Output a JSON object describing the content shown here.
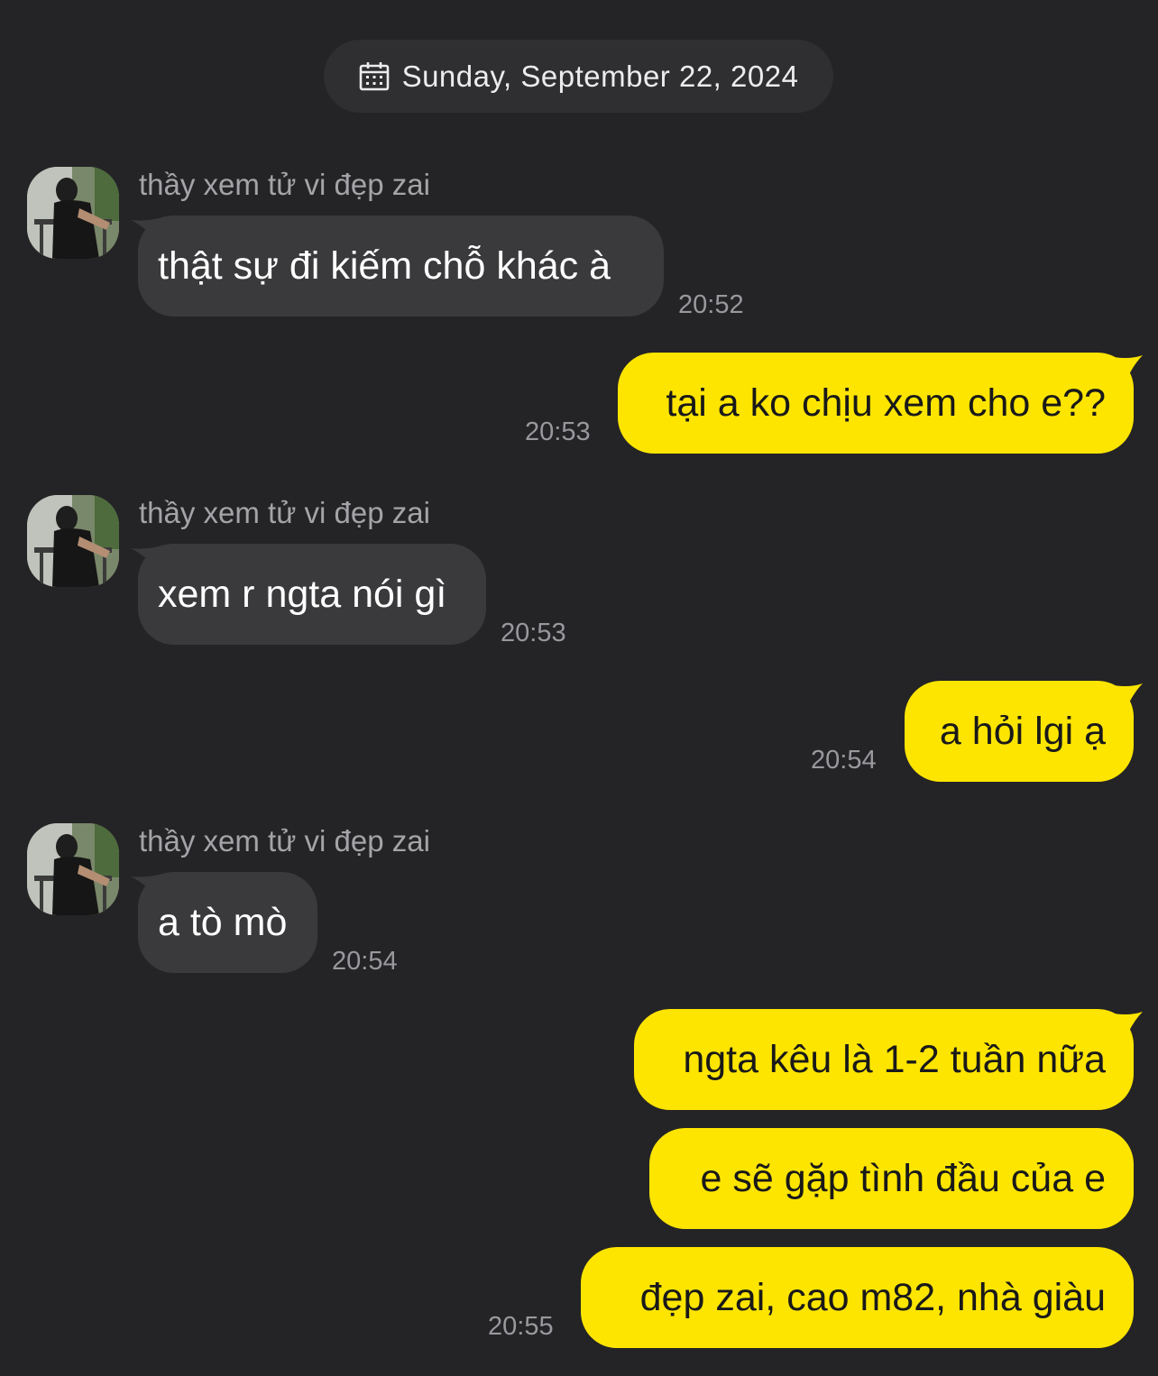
{
  "date_divider": {
    "icon": "calendar-icon",
    "text": "Sunday, September 22, 2024"
  },
  "colors": {
    "background": "#242426",
    "incoming_bubble": "#3a3a3c",
    "outgoing_bubble": "#fee500",
    "timestamp": "#98989d"
  },
  "messages": [
    {
      "sender": "thầy xem tử vi đẹp zai",
      "text": "thật sự đi kiếm chỗ khác à",
      "time": "20:52"
    },
    {
      "text": "tại a ko chịu xem cho e??",
      "time": "20:53"
    },
    {
      "sender": "thầy xem tử vi đẹp zai",
      "text": "xem r ngta nói gì",
      "time": "20:53"
    },
    {
      "text": "a hỏi lgi ạ",
      "time": "20:54"
    },
    {
      "sender": "thầy xem tử vi đẹp zai",
      "text": "a tò mò",
      "time": "20:54"
    },
    {
      "text": "ngta kêu là 1-2 tuần nữa"
    },
    {
      "text": "e sẽ gặp tình đầu của e"
    },
    {
      "text": "đẹp zai, cao m82, nhà giàu",
      "time": "20:55"
    }
  ]
}
